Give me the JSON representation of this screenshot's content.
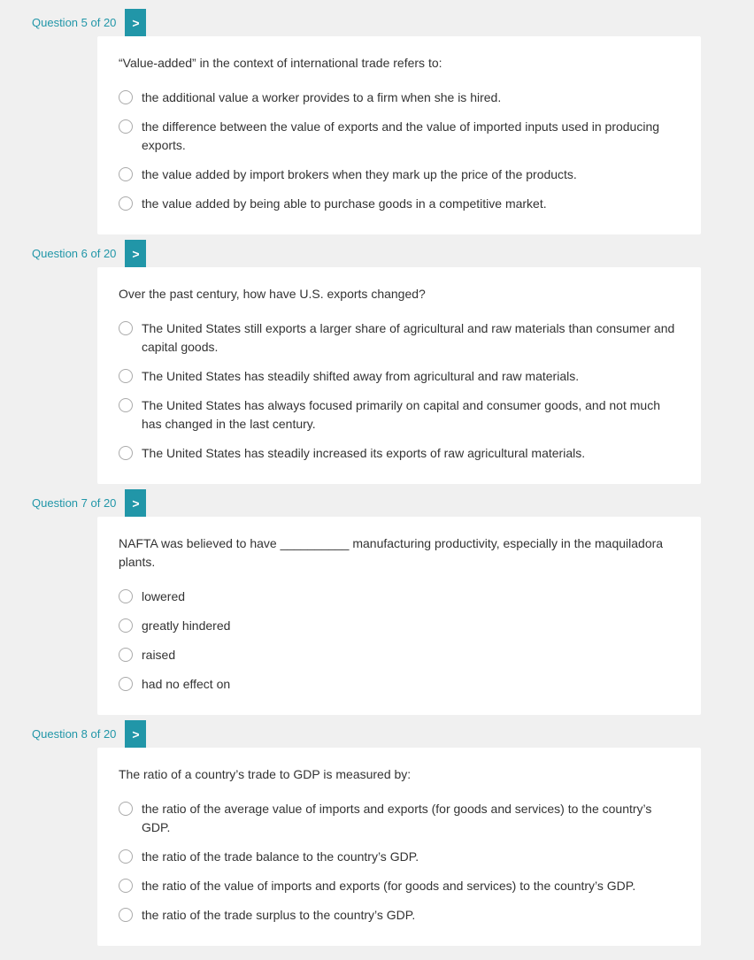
{
  "questions": [
    {
      "id": "q5",
      "label": "Question 5 of 20",
      "text": "“Value-added” in the context of international trade refers to:",
      "options": [
        "the additional value a worker provides to a firm when she is hired.",
        "the difference between the value of exports and the value of imported inputs used in producing exports.",
        "the value added by import brokers when they mark up the price of the products.",
        "the value added by being able to purchase goods in a competitive market."
      ]
    },
    {
      "id": "q6",
      "label": "Question 6 of 20",
      "text": "Over the past century, how have U.S. exports changed?",
      "options": [
        "The United States still exports a larger share of agricultural and raw materials than consumer and capital goods.",
        "The United States has steadily shifted away from agricultural and raw materials.",
        "The United States has always focused primarily on capital and consumer goods, and not much has changed in the last century.",
        "The United States has steadily increased its exports of raw agricultural materials."
      ]
    },
    {
      "id": "q7",
      "label": "Question 7 of 20",
      "text": "NAFTA was believed to have __________ manufacturing productivity, especially in the maquiladora plants.",
      "options": [
        "lowered",
        "greatly hindered",
        "raised",
        "had no effect on"
      ]
    },
    {
      "id": "q8",
      "label": "Question 8 of 20",
      "text": "The ratio of a country’s trade to GDP is measured by:",
      "options": [
        "the ratio of the average value of imports and exports (for goods and services) to the country’s GDP.",
        "the ratio of the trade balance to the country’s GDP.",
        "the ratio of the value of imports and exports (for goods and services) to the country’s GDP.",
        "the ratio of the trade surplus to the country’s GDP."
      ]
    }
  ],
  "arrow_symbol": ">"
}
